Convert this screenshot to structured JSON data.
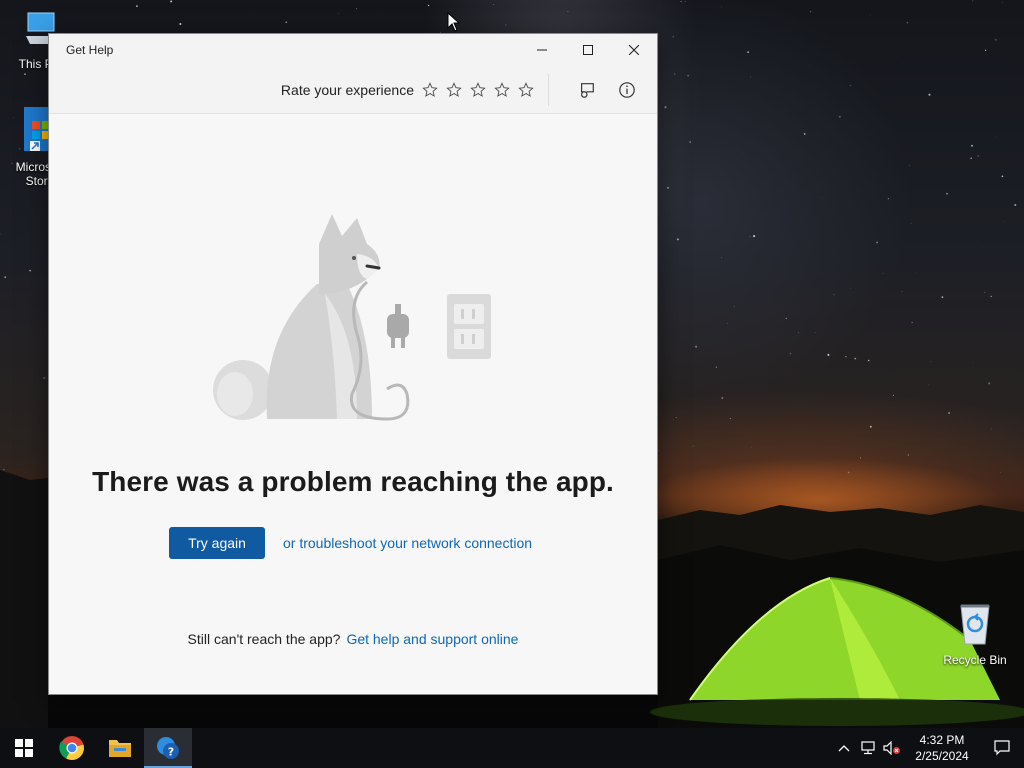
{
  "desktop": {
    "icons": [
      {
        "label": "This PC",
        "icon": "this-pc-icon"
      },
      {
        "label": "Microsoft Store",
        "icon": "store-icon"
      },
      {
        "label": "Recycle Bin",
        "icon": "recycle-bin-icon"
      }
    ]
  },
  "window": {
    "title": "Get Help",
    "controls": [
      "minimize-icon",
      "maximize-icon",
      "close-icon"
    ],
    "toolbar": {
      "rate_label": "Rate your experience",
      "rating_stars": 5,
      "rating_selected": 0
    },
    "error": {
      "title": "There was a problem reaching the app.",
      "try_again": "Try again",
      "troubleshoot_link": "or troubleshoot your network connection",
      "footer_text": "Still can't reach the app?",
      "footer_link": "Get help and support online"
    }
  },
  "taskbar": {
    "apps": [
      "start-icon",
      "chrome-icon",
      "file-explorer-icon",
      "get-help-icon"
    ],
    "active_app": "get-help-icon",
    "clock": {
      "time": "4:32 PM",
      "date": "2/25/2024"
    }
  },
  "colors": {
    "accent": "#0f5aa0",
    "link": "#0e67b4",
    "window_bg": "#f7f7f7",
    "taskbar_bg": "#0d0f13"
  }
}
